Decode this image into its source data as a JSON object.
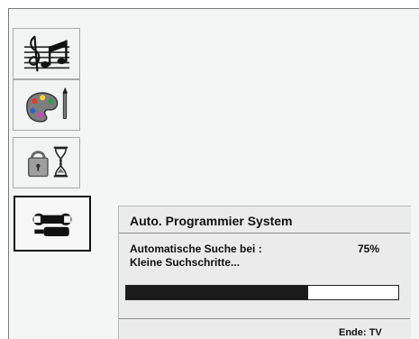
{
  "menu": {
    "tabs": [
      {
        "id": "sound",
        "icon": "music-notes-icon",
        "selected": false
      },
      {
        "id": "picture",
        "icon": "paint-palette-icon",
        "selected": false
      },
      {
        "id": "security-timer",
        "icon": "lock-hourglass-icon",
        "selected": false
      },
      {
        "id": "setup",
        "icon": "tools-icon",
        "selected": true
      }
    ]
  },
  "dialog": {
    "title": "Auto. Programmier System",
    "status_label": "Automatische Suche bei :",
    "progress_text": "75%",
    "progress_fraction": 0.67,
    "step_text": "Kleine Suchschritte...",
    "footer_hint": "Ende: TV"
  },
  "colors": {
    "panel_background": "#f4f5f5",
    "dialog_background": "#ebebec",
    "progress_fill": "#1b1b1b",
    "selected_border": "#111111"
  }
}
